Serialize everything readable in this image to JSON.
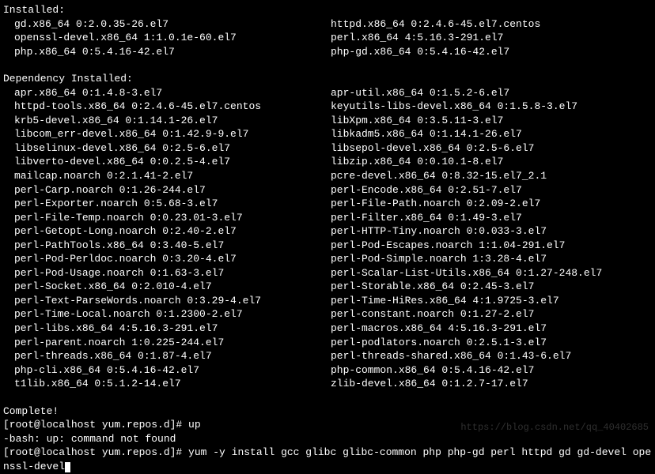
{
  "installed_header": "Installed:",
  "installed": [
    {
      "left": "gd.x86_64 0:2.0.35-26.el7",
      "right": "httpd.x86_64 0:2.4.6-45.el7.centos"
    },
    {
      "left": "openssl-devel.x86_64 1:1.0.1e-60.el7",
      "right": "perl.x86_64 4:5.16.3-291.el7"
    },
    {
      "left": "php.x86_64 0:5.4.16-42.el7",
      "right": "php-gd.x86_64 0:5.4.16-42.el7"
    }
  ],
  "dep_header": "Dependency Installed:",
  "deps": [
    {
      "left": "apr.x86_64 0:1.4.8-3.el7",
      "right": "apr-util.x86_64 0:1.5.2-6.el7"
    },
    {
      "left": "httpd-tools.x86_64 0:2.4.6-45.el7.centos",
      "right": "keyutils-libs-devel.x86_64 0:1.5.8-3.el7"
    },
    {
      "left": "krb5-devel.x86_64 0:1.14.1-26.el7",
      "right": "libXpm.x86_64 0:3.5.11-3.el7"
    },
    {
      "left": "libcom_err-devel.x86_64 0:1.42.9-9.el7",
      "right": "libkadm5.x86_64 0:1.14.1-26.el7"
    },
    {
      "left": "libselinux-devel.x86_64 0:2.5-6.el7",
      "right": "libsepol-devel.x86_64 0:2.5-6.el7"
    },
    {
      "left": "libverto-devel.x86_64 0:0.2.5-4.el7",
      "right": "libzip.x86_64 0:0.10.1-8.el7"
    },
    {
      "left": "mailcap.noarch 0:2.1.41-2.el7",
      "right": "pcre-devel.x86_64 0:8.32-15.el7_2.1"
    },
    {
      "left": "perl-Carp.noarch 0:1.26-244.el7",
      "right": "perl-Encode.x86_64 0:2.51-7.el7"
    },
    {
      "left": "perl-Exporter.noarch 0:5.68-3.el7",
      "right": "perl-File-Path.noarch 0:2.09-2.el7"
    },
    {
      "left": "perl-File-Temp.noarch 0:0.23.01-3.el7",
      "right": "perl-Filter.x86_64 0:1.49-3.el7"
    },
    {
      "left": "perl-Getopt-Long.noarch 0:2.40-2.el7",
      "right": "perl-HTTP-Tiny.noarch 0:0.033-3.el7"
    },
    {
      "left": "perl-PathTools.x86_64 0:3.40-5.el7",
      "right": "perl-Pod-Escapes.noarch 1:1.04-291.el7"
    },
    {
      "left": "perl-Pod-Perldoc.noarch 0:3.20-4.el7",
      "right": "perl-Pod-Simple.noarch 1:3.28-4.el7"
    },
    {
      "left": "perl-Pod-Usage.noarch 0:1.63-3.el7",
      "right": "perl-Scalar-List-Utils.x86_64 0:1.27-248.el7"
    },
    {
      "left": "perl-Socket.x86_64 0:2.010-4.el7",
      "right": "perl-Storable.x86_64 0:2.45-3.el7"
    },
    {
      "left": "perl-Text-ParseWords.noarch 0:3.29-4.el7",
      "right": "perl-Time-HiRes.x86_64 4:1.9725-3.el7"
    },
    {
      "left": "perl-Time-Local.noarch 0:1.2300-2.el7",
      "right": "perl-constant.noarch 0:1.27-2.el7"
    },
    {
      "left": "perl-libs.x86_64 4:5.16.3-291.el7",
      "right": "perl-macros.x86_64 4:5.16.3-291.el7"
    },
    {
      "left": "perl-parent.noarch 1:0.225-244.el7",
      "right": "perl-podlators.noarch 0:2.5.1-3.el7"
    },
    {
      "left": "perl-threads.x86_64 0:1.87-4.el7",
      "right": "perl-threads-shared.x86_64 0:1.43-6.el7"
    },
    {
      "left": "php-cli.x86_64 0:5.4.16-42.el7",
      "right": "php-common.x86_64 0:5.4.16-42.el7"
    },
    {
      "left": "t1lib.x86_64 0:5.1.2-14.el7",
      "right": "zlib-devel.x86_64 0:1.2.7-17.el7"
    }
  ],
  "complete_line": "Complete!",
  "prompt1_prefix": "[root@localhost yum.repos.d]# ",
  "prompt1_cmd": "up",
  "error_line": "-bash: up: command not found",
  "prompt2_prefix": "[root@localhost yum.repos.d]# ",
  "prompt2_cmd": "yum -y install gcc glibc glibc-common php php-gd perl httpd gd gd-devel openssl-devel",
  "watermark": "https://blog.csdn.net/qq_40402685"
}
